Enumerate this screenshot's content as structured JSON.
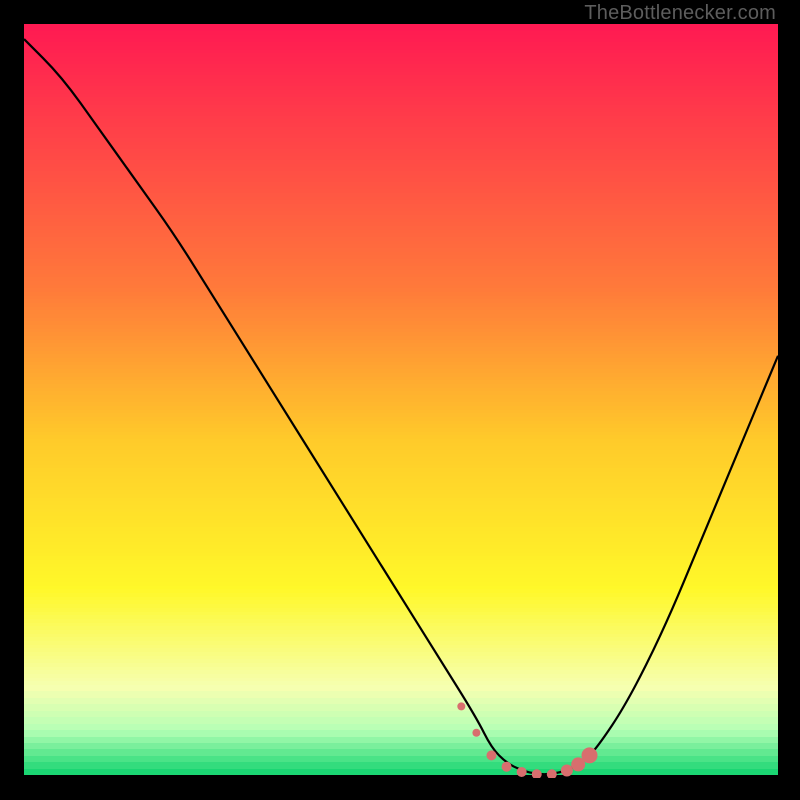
{
  "watermark": "TheBottlenecker.com",
  "chart_data": {
    "type": "line",
    "title": "",
    "xlabel": "",
    "ylabel": "",
    "xlim": [
      0,
      100
    ],
    "ylim": [
      0,
      100
    ],
    "grid": false,
    "background_gradient": [
      {
        "pos": 0.0,
        "color": "#ff1a52"
      },
      {
        "pos": 0.35,
        "color": "#ff7a3a"
      },
      {
        "pos": 0.55,
        "color": "#ffca2a"
      },
      {
        "pos": 0.75,
        "color": "#fff829"
      },
      {
        "pos": 0.88,
        "color": "#f6ffb0"
      },
      {
        "pos": 0.94,
        "color": "#b5ffb5"
      },
      {
        "pos": 1.0,
        "color": "#1bd673"
      }
    ],
    "series": [
      {
        "name": "bottleneck-curve",
        "color": "#000000",
        "x": [
          0,
          5,
          10,
          15,
          20,
          25,
          30,
          35,
          40,
          45,
          50,
          55,
          60,
          62,
          64,
          66,
          68,
          70,
          72,
          74,
          76,
          80,
          85,
          90,
          95,
          100
        ],
        "y": [
          98,
          93,
          86,
          79,
          72,
          64,
          56,
          48,
          40,
          32,
          24,
          16,
          8,
          4,
          2,
          1,
          0.5,
          0.5,
          1,
          2,
          4,
          10,
          20,
          32,
          44,
          56
        ]
      }
    ],
    "markers": {
      "name": "optimal-range",
      "color": "#d86e6e",
      "points": [
        {
          "x": 58,
          "y": 9.5,
          "r": 4
        },
        {
          "x": 60,
          "y": 6,
          "r": 4
        },
        {
          "x": 62,
          "y": 3,
          "r": 5
        },
        {
          "x": 64,
          "y": 1.5,
          "r": 5
        },
        {
          "x": 66,
          "y": 0.8,
          "r": 5
        },
        {
          "x": 68,
          "y": 0.5,
          "r": 5
        },
        {
          "x": 70,
          "y": 0.5,
          "r": 5
        },
        {
          "x": 72,
          "y": 1,
          "r": 6
        },
        {
          "x": 73.5,
          "y": 1.8,
          "r": 7
        },
        {
          "x": 75,
          "y": 3,
          "r": 8
        }
      ]
    }
  }
}
